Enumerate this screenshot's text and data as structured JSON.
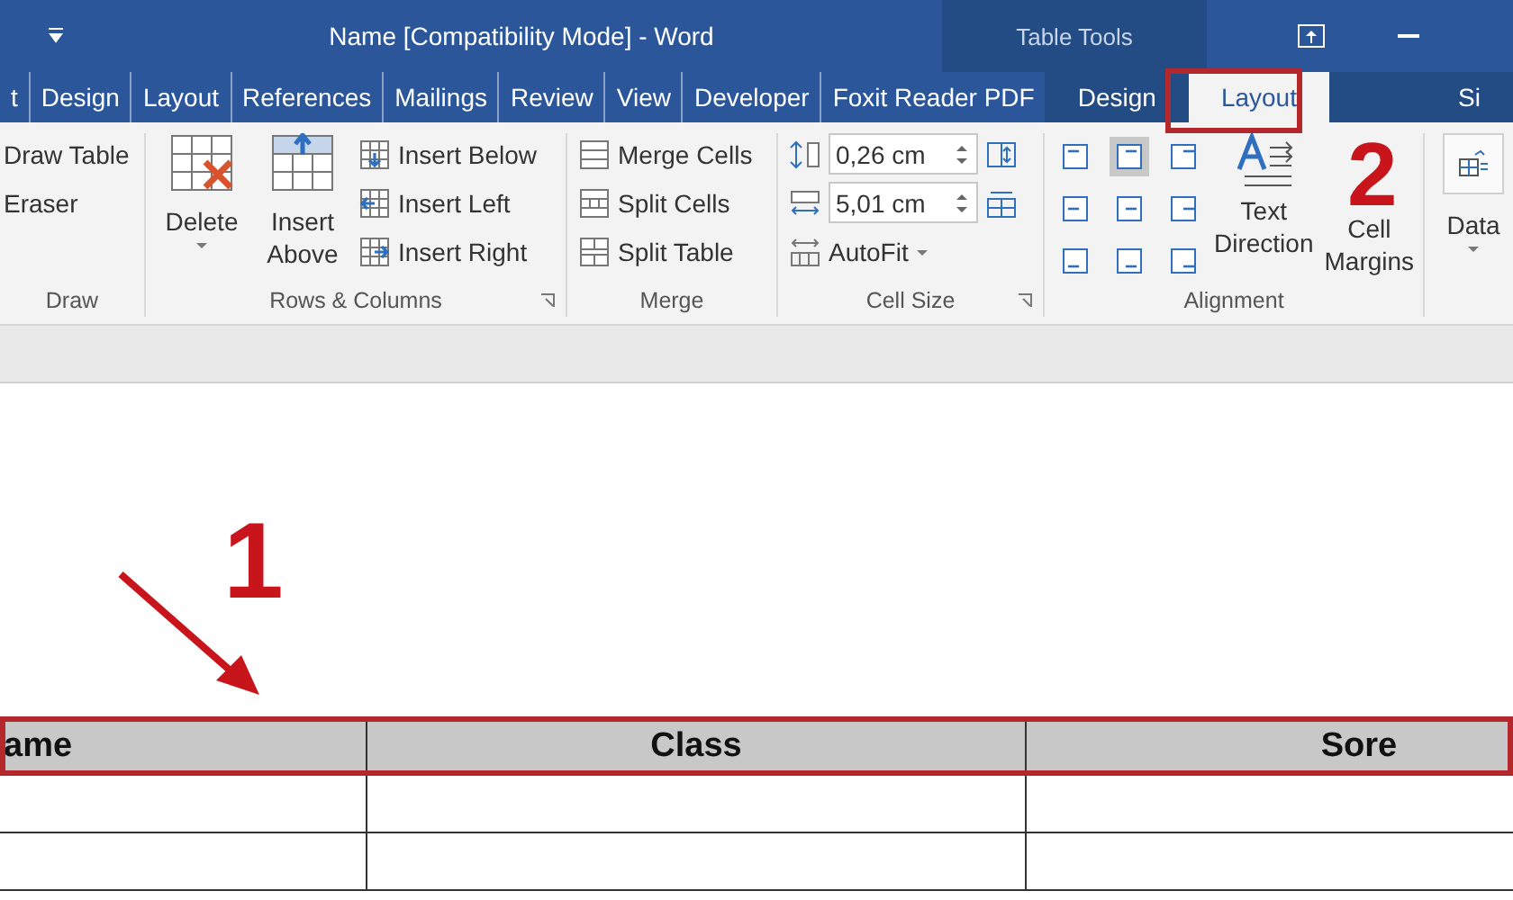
{
  "title_bar": {
    "title": "Name [Compatibility Mode] - Word",
    "context_title": "Table Tools"
  },
  "tabs": [
    {
      "label": "t",
      "kind": "main",
      "selected": false
    },
    {
      "label": "Design",
      "kind": "main",
      "selected": false
    },
    {
      "label": "Layout",
      "kind": "main",
      "selected": false
    },
    {
      "label": "References",
      "kind": "main",
      "selected": false
    },
    {
      "label": "Mailings",
      "kind": "main",
      "selected": false
    },
    {
      "label": "Review",
      "kind": "main",
      "selected": false
    },
    {
      "label": "View",
      "kind": "main",
      "selected": false
    },
    {
      "label": "Developer",
      "kind": "main",
      "selected": false
    },
    {
      "label": "Foxit Reader PDF",
      "kind": "main",
      "selected": false
    },
    {
      "label": "Design",
      "kind": "context",
      "selected": false
    },
    {
      "label": "Layout",
      "kind": "context",
      "selected": true
    },
    {
      "label": "Si",
      "kind": "context",
      "selected": false
    }
  ],
  "ribbon": {
    "draw": {
      "label": "Draw",
      "items": [
        "Draw Table",
        "Eraser"
      ]
    },
    "rows_columns": {
      "label": "Rows & Columns",
      "delete": "Delete",
      "insert_above": [
        "Insert",
        "Above"
      ],
      "small": [
        {
          "label": "Insert Below",
          "kind": "below"
        },
        {
          "label": "Insert Left",
          "kind": "left"
        },
        {
          "label": "Insert Right",
          "kind": "right"
        }
      ]
    },
    "merge": {
      "label": "Merge",
      "items": [
        {
          "label": "Merge Cells",
          "kind": "merge"
        },
        {
          "label": "Split Cells",
          "kind": "split"
        },
        {
          "label": "Split Table",
          "kind": "table"
        }
      ]
    },
    "cell_size": {
      "label": "Cell Size",
      "height": "0,26 cm",
      "width": "5,01 cm",
      "autofit": "AutoFit"
    },
    "alignment": {
      "label": "Alignment",
      "buttons": [
        {
          "selected": false
        },
        {
          "selected": true
        },
        {
          "selected": false
        },
        {
          "selected": false
        },
        {
          "selected": false
        },
        {
          "selected": false
        },
        {
          "selected": false
        },
        {
          "selected": false
        },
        {
          "selected": false
        }
      ],
      "text_direction": [
        "Text",
        "Direction"
      ],
      "cell_margins": [
        "Cell",
        "Margins"
      ]
    },
    "data": {
      "label": "Data"
    }
  },
  "table": {
    "columns": [
      {
        "label": "ame"
      },
      {
        "label": "Class"
      },
      {
        "label": "Sore"
      }
    ]
  },
  "annotations": [
    {
      "label": "1"
    },
    {
      "label": "2"
    }
  ]
}
